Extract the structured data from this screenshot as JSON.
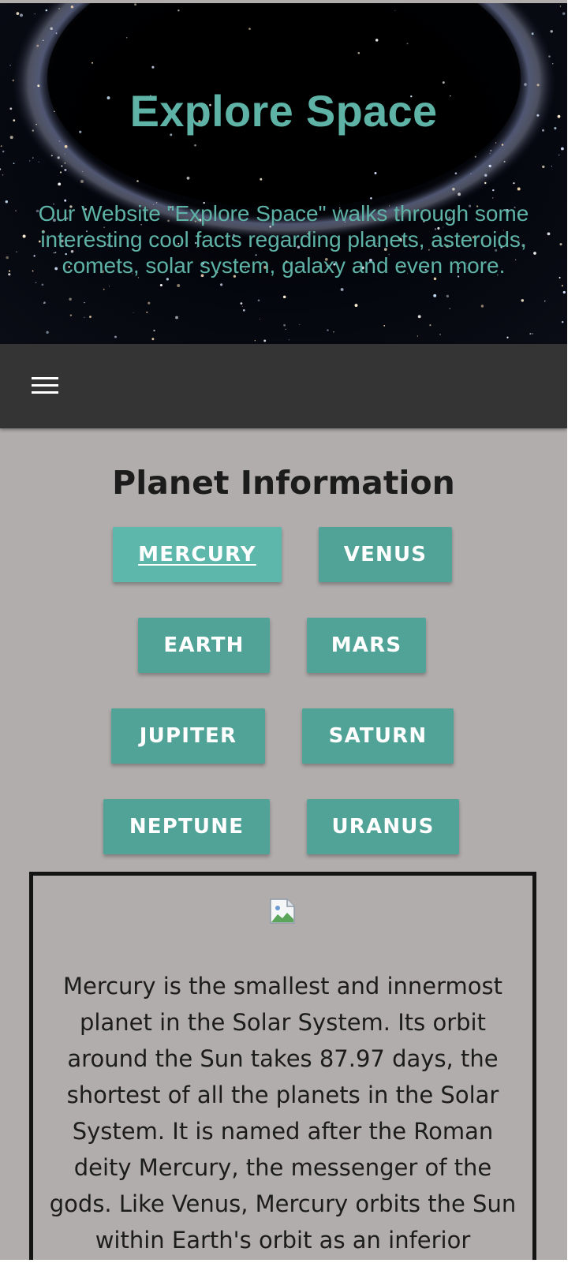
{
  "header": {
    "title": "Explore Space",
    "description": "Our Website \"Explore Space\" walks through some interesting cool facts regarding planets, asteroids, comets, solar system, galaxy and even more."
  },
  "nav": {
    "menu_icon": "hamburger-menu-icon"
  },
  "main": {
    "section_title": "Planet Information",
    "active_planet": "MERCURY",
    "planets": [
      {
        "label": "MERCURY"
      },
      {
        "label": "VENUS"
      },
      {
        "label": "EARTH"
      },
      {
        "label": "MARS"
      },
      {
        "label": "JUPITER"
      },
      {
        "label": "SATURN"
      },
      {
        "label": "NEPTUNE"
      },
      {
        "label": "URANUS"
      }
    ],
    "info": {
      "image_icon": "broken-image-icon",
      "text": "Mercury is the smallest and innermost planet in the Solar System. Its orbit around the Sun takes 87.97 days, the shortest of all the planets in the Solar System. It is named after the Roman deity Mercury, the messenger of the gods. Like Venus, Mercury orbits the Sun within Earth's orbit as an inferior"
    }
  },
  "colors": {
    "accent_teal": "#52a397",
    "accent_teal_active": "#5db7ab",
    "hero_text": "#5eb3a6",
    "navbar_bg": "#343434",
    "page_bg": "#b1adac"
  }
}
